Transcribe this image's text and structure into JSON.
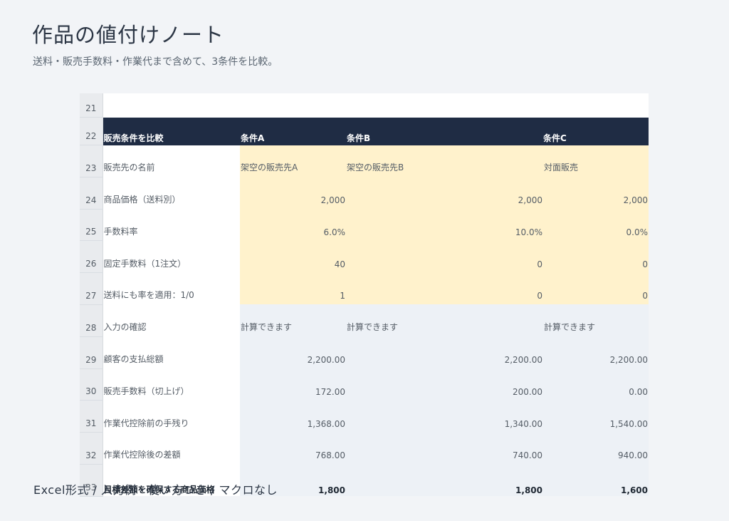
{
  "header": {
    "title": "作品の値付けノート",
    "subtitle": "送料・販売手数料・作業代まで含めて、3条件を比較。"
  },
  "sheet": {
    "header_row": {
      "row_number": "22",
      "label": "販売条件を比較",
      "a": "条件A",
      "b": "条件B",
      "c": "条件C"
    },
    "empty_row_number": "21",
    "rows": [
      {
        "n": "23",
        "label": "販売先の名前",
        "a": "架空の販売先A",
        "b": "架空の販売先B",
        "c": "対面販売"
      },
      {
        "n": "24",
        "label": "商品価格（送料別）",
        "a": "2,000",
        "b": "2,000",
        "c": "2,000"
      },
      {
        "n": "25",
        "label": "手数料率",
        "a": "6.0%",
        "b": "10.0%",
        "c": "0.0%"
      },
      {
        "n": "26",
        "label": "固定手数料（1注文）",
        "a": "40",
        "b": "0",
        "c": "0"
      },
      {
        "n": "27",
        "label": "送料にも率を適用：1/0",
        "a": "1",
        "b": "0",
        "c": "0"
      },
      {
        "n": "28",
        "label": "入力の確認",
        "a": "計算できます",
        "b": "計算できます",
        "c": "計算できます"
      },
      {
        "n": "29",
        "label": "顧客の支払総額",
        "a": "2,200.00",
        "b": "2,200.00",
        "c": "2,200.00"
      },
      {
        "n": "30",
        "label": "販売手数料（切上げ）",
        "a": "172.00",
        "b": "200.00",
        "c": "0.00"
      },
      {
        "n": "31",
        "label": "作業代控除前の手残り",
        "a": "1,368.00",
        "b": "1,340.00",
        "c": "1,540.00"
      },
      {
        "n": "32",
        "label": "作業代控除後の差額",
        "a": "768.00",
        "b": "740.00",
        "c": "940.00"
      },
      {
        "n": "33",
        "label": "目標差額を確保する商品価格",
        "a": "1,800",
        "b": "1,800",
        "c": "1,600"
      }
    ]
  },
  "footer": {
    "text": "Excel形式 / 入力例・使い方つき / マクロなし"
  }
}
